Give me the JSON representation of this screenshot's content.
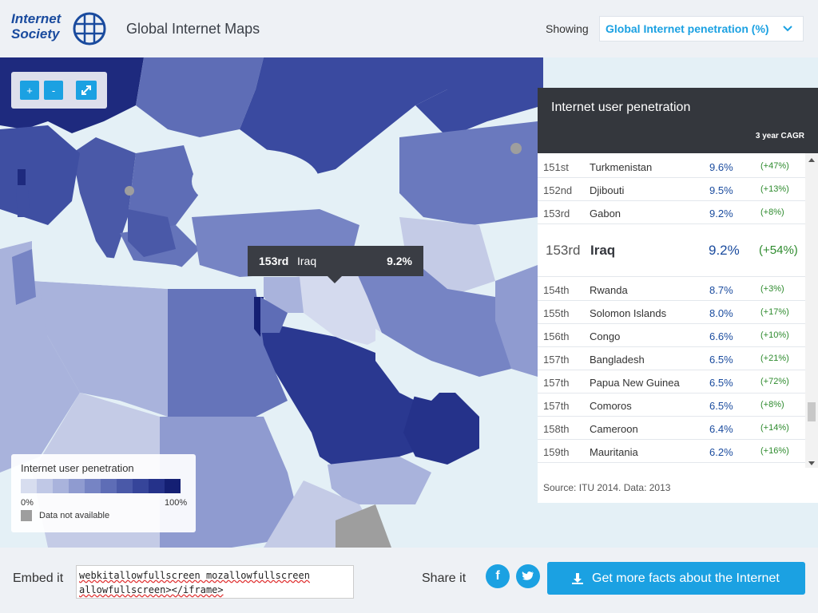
{
  "header": {
    "logo_line1": "Internet",
    "logo_line2": "Society",
    "app_title": "Global Internet Maps",
    "showing_label": "Showing",
    "metric_selected": "Global Internet penetration (%)"
  },
  "map": {
    "zoom_in": "+",
    "zoom_out": "-",
    "tooltip": {
      "rank": "153rd",
      "country": "Iraq",
      "value": "9.2%"
    },
    "legend": {
      "title": "Internet user penetration",
      "min_label": "0%",
      "max_label": "100%",
      "na_label": "Data not available",
      "ramp_colors": [
        "#d7ddef",
        "#c0c8e6",
        "#a9b3dc",
        "#8f9bd0",
        "#7684c4",
        "#5e6db6",
        "#4a59a8",
        "#36459a",
        "#25328a",
        "#141f73"
      ]
    }
  },
  "panel": {
    "title": "Internet user penetration",
    "cagr_label": "3 year CAGR",
    "rows": [
      {
        "rank": "151st",
        "country": "Turkmenistan",
        "value": "9.6%",
        "change": "(+47%)"
      },
      {
        "rank": "152nd",
        "country": "Djibouti",
        "value": "9.5%",
        "change": "(+13%)"
      },
      {
        "rank": "153rd",
        "country": "Gabon",
        "value": "9.2%",
        "change": "(+8%)"
      }
    ],
    "highlight": {
      "rank": "153rd",
      "country": "Iraq",
      "value": "9.2%",
      "change": "(+54%)"
    },
    "rows_after": [
      {
        "rank": "154th",
        "country": "Rwanda",
        "value": "8.7%",
        "change": "(+3%)"
      },
      {
        "rank": "155th",
        "country": "Solomon Islands",
        "value": "8.0%",
        "change": "(+17%)"
      },
      {
        "rank": "156th",
        "country": "Congo",
        "value": "6.6%",
        "change": "(+10%)"
      },
      {
        "rank": "157th",
        "country": "Bangladesh",
        "value": "6.5%",
        "change": "(+21%)"
      },
      {
        "rank": "157th",
        "country": "Papua New Guinea",
        "value": "6.5%",
        "change": "(+72%)"
      },
      {
        "rank": "157th",
        "country": "Comoros",
        "value": "6.5%",
        "change": "(+8%)"
      },
      {
        "rank": "158th",
        "country": "Cameroon",
        "value": "6.4%",
        "change": "(+14%)"
      },
      {
        "rank": "159th",
        "country": "Mauritania",
        "value": "6.2%",
        "change": "(+16%)"
      }
    ],
    "source": "Source: ITU 2014. Data: 2013"
  },
  "footer": {
    "embed_label": "Embed it",
    "embed_line1": "webkitallowfullscreen mozallowfullscreen",
    "embed_line2": "allowfullscreen></iframe>",
    "share_label": "Share it",
    "facebook": "f",
    "cta_label": "Get more facts about the Internet"
  },
  "colors": {
    "accent": "#1ba1e2",
    "brand": "#1a4b9e",
    "panel_header": "#34373d",
    "positive": "#2e8b2e"
  }
}
